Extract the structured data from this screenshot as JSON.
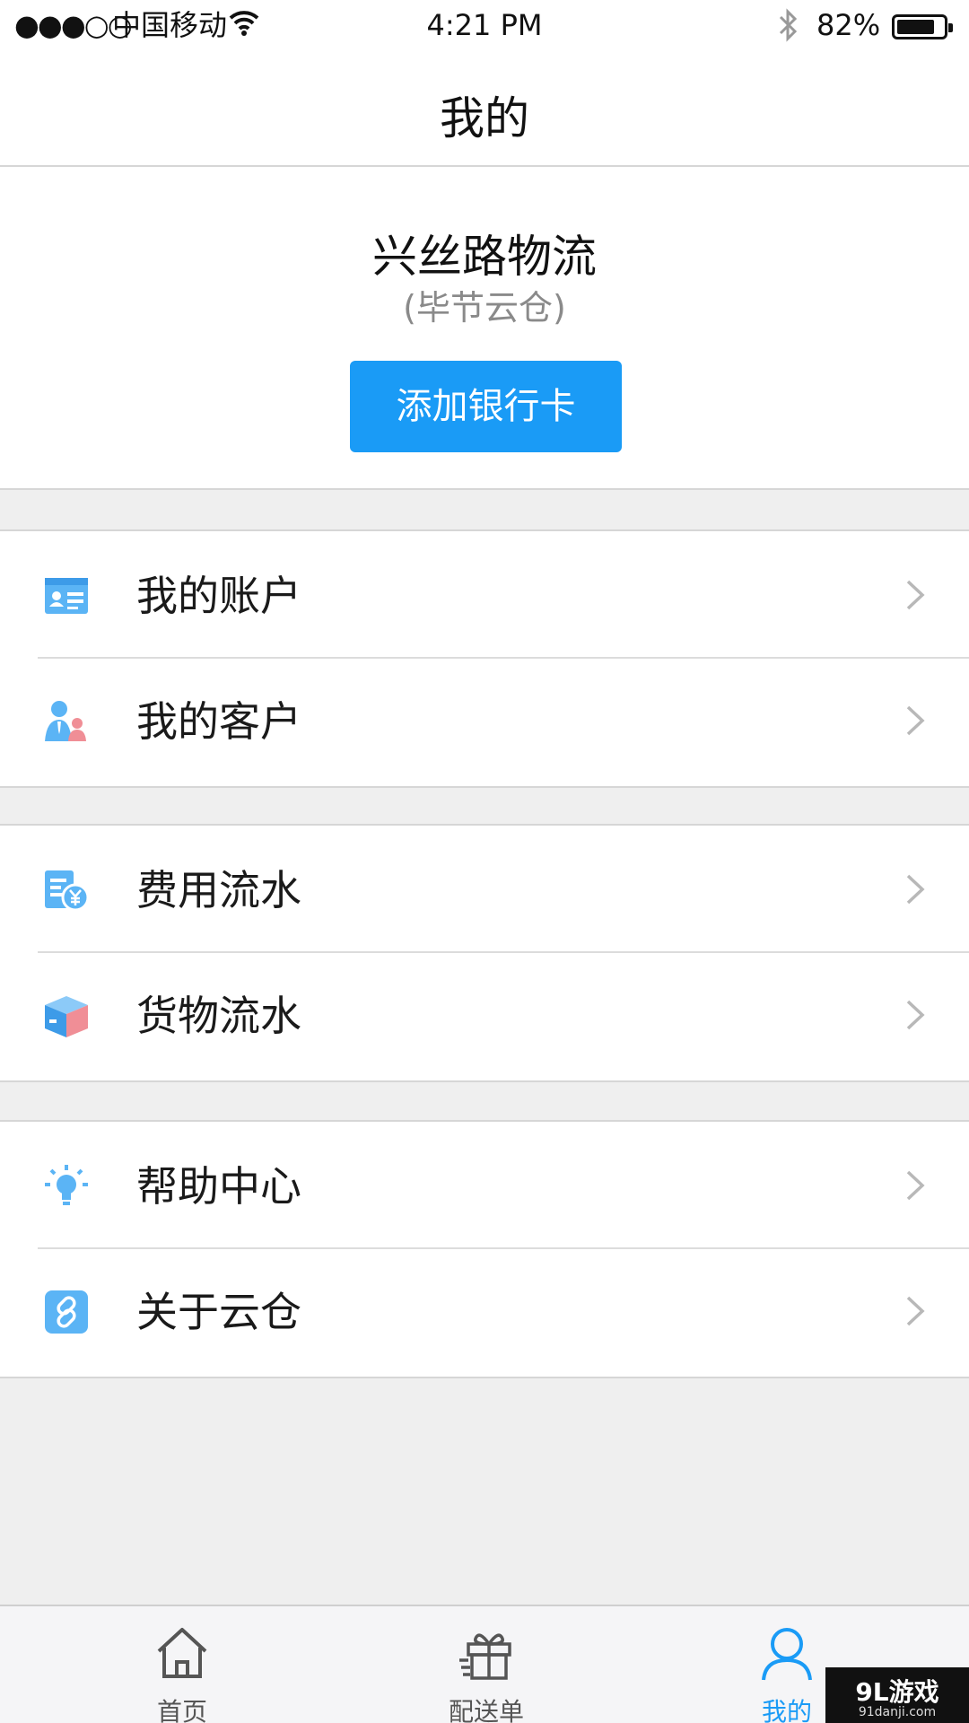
{
  "status_bar": {
    "signal": "●●●○○",
    "carrier": "中国移动",
    "time": "4:21 PM",
    "battery_percent": "82%",
    "battery_level": 0.82
  },
  "nav": {
    "title": "我的"
  },
  "profile": {
    "company_name": "兴丝路物流",
    "company_sub": "(毕节云仓)",
    "add_card_label": "添加银行卡"
  },
  "menu": {
    "account": {
      "label": "我的账户",
      "icon": "id-card-icon"
    },
    "customers": {
      "label": "我的客户",
      "icon": "customers-icon"
    },
    "fees": {
      "label": "费用流水",
      "icon": "fee-ledger-icon"
    },
    "goods": {
      "label": "货物流水",
      "icon": "package-icon"
    },
    "help": {
      "label": "帮助中心",
      "icon": "lightbulb-icon"
    },
    "about": {
      "label": "关于云仓",
      "icon": "link-icon"
    }
  },
  "tabs": [
    {
      "label": "首页",
      "icon": "home-icon",
      "active": false
    },
    {
      "label": "配送单",
      "icon": "gift-icon",
      "active": false
    },
    {
      "label": "我的",
      "icon": "user-icon",
      "active": true
    }
  ],
  "watermark": {
    "main": "9L游戏",
    "sub": "91danji.com"
  },
  "colors": {
    "accent": "#1a9bf6",
    "icon_blue": "#5bb4f5",
    "icon_pink": "#f08e96",
    "background": "#efefef"
  }
}
